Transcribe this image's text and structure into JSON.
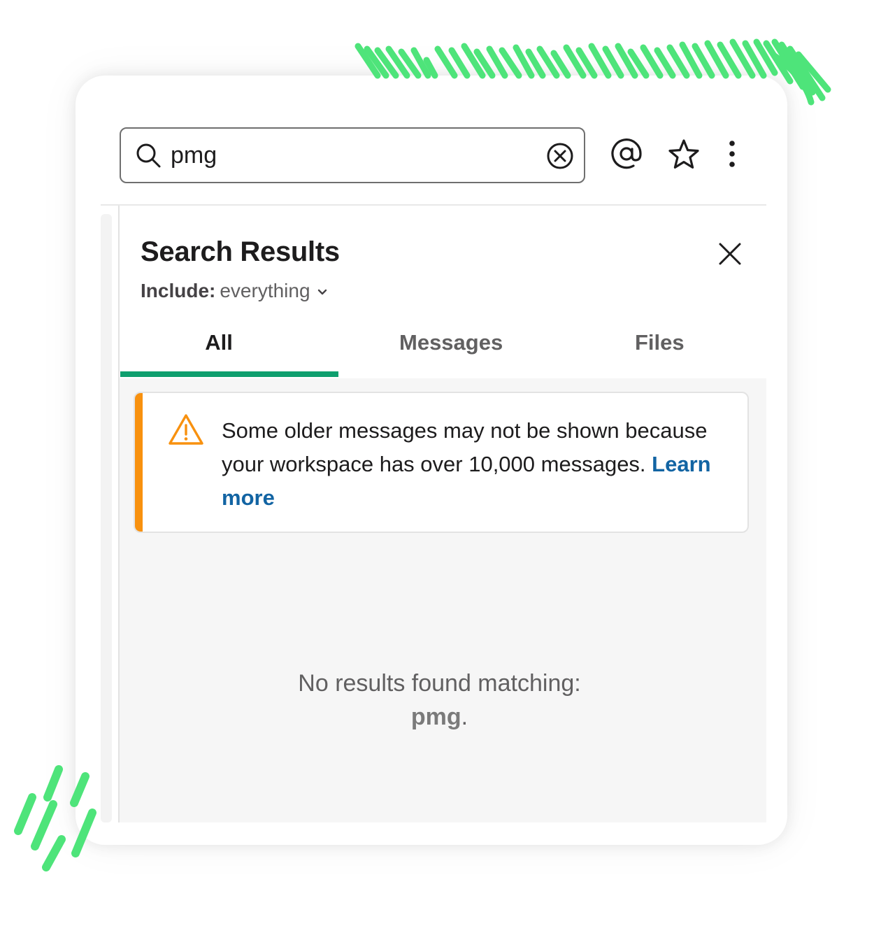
{
  "search": {
    "value": "pmg",
    "placeholder": ""
  },
  "header_icons": [
    "search-icon",
    "clear-icon",
    "at-mention-icon",
    "star-icon",
    "more-vertical-icon"
  ],
  "panel": {
    "title": "Search Results",
    "include_label": "Include:",
    "include_value": "everything",
    "tabs": [
      {
        "label": "All",
        "selected": true
      },
      {
        "label": "Messages",
        "selected": false
      },
      {
        "label": "Files",
        "selected": false
      }
    ]
  },
  "notice": {
    "text": "Some older messages may not be shown because your workspace has over 10,000 messages.",
    "link": "Learn more"
  },
  "empty_state": {
    "line1": "No results found matching:",
    "query": "pmg",
    "suffix": "."
  },
  "colors": {
    "tab_accent": "#0e9f6e",
    "warning": "#f8910f",
    "link": "#1264a3",
    "decoration": "#4ee47a"
  }
}
